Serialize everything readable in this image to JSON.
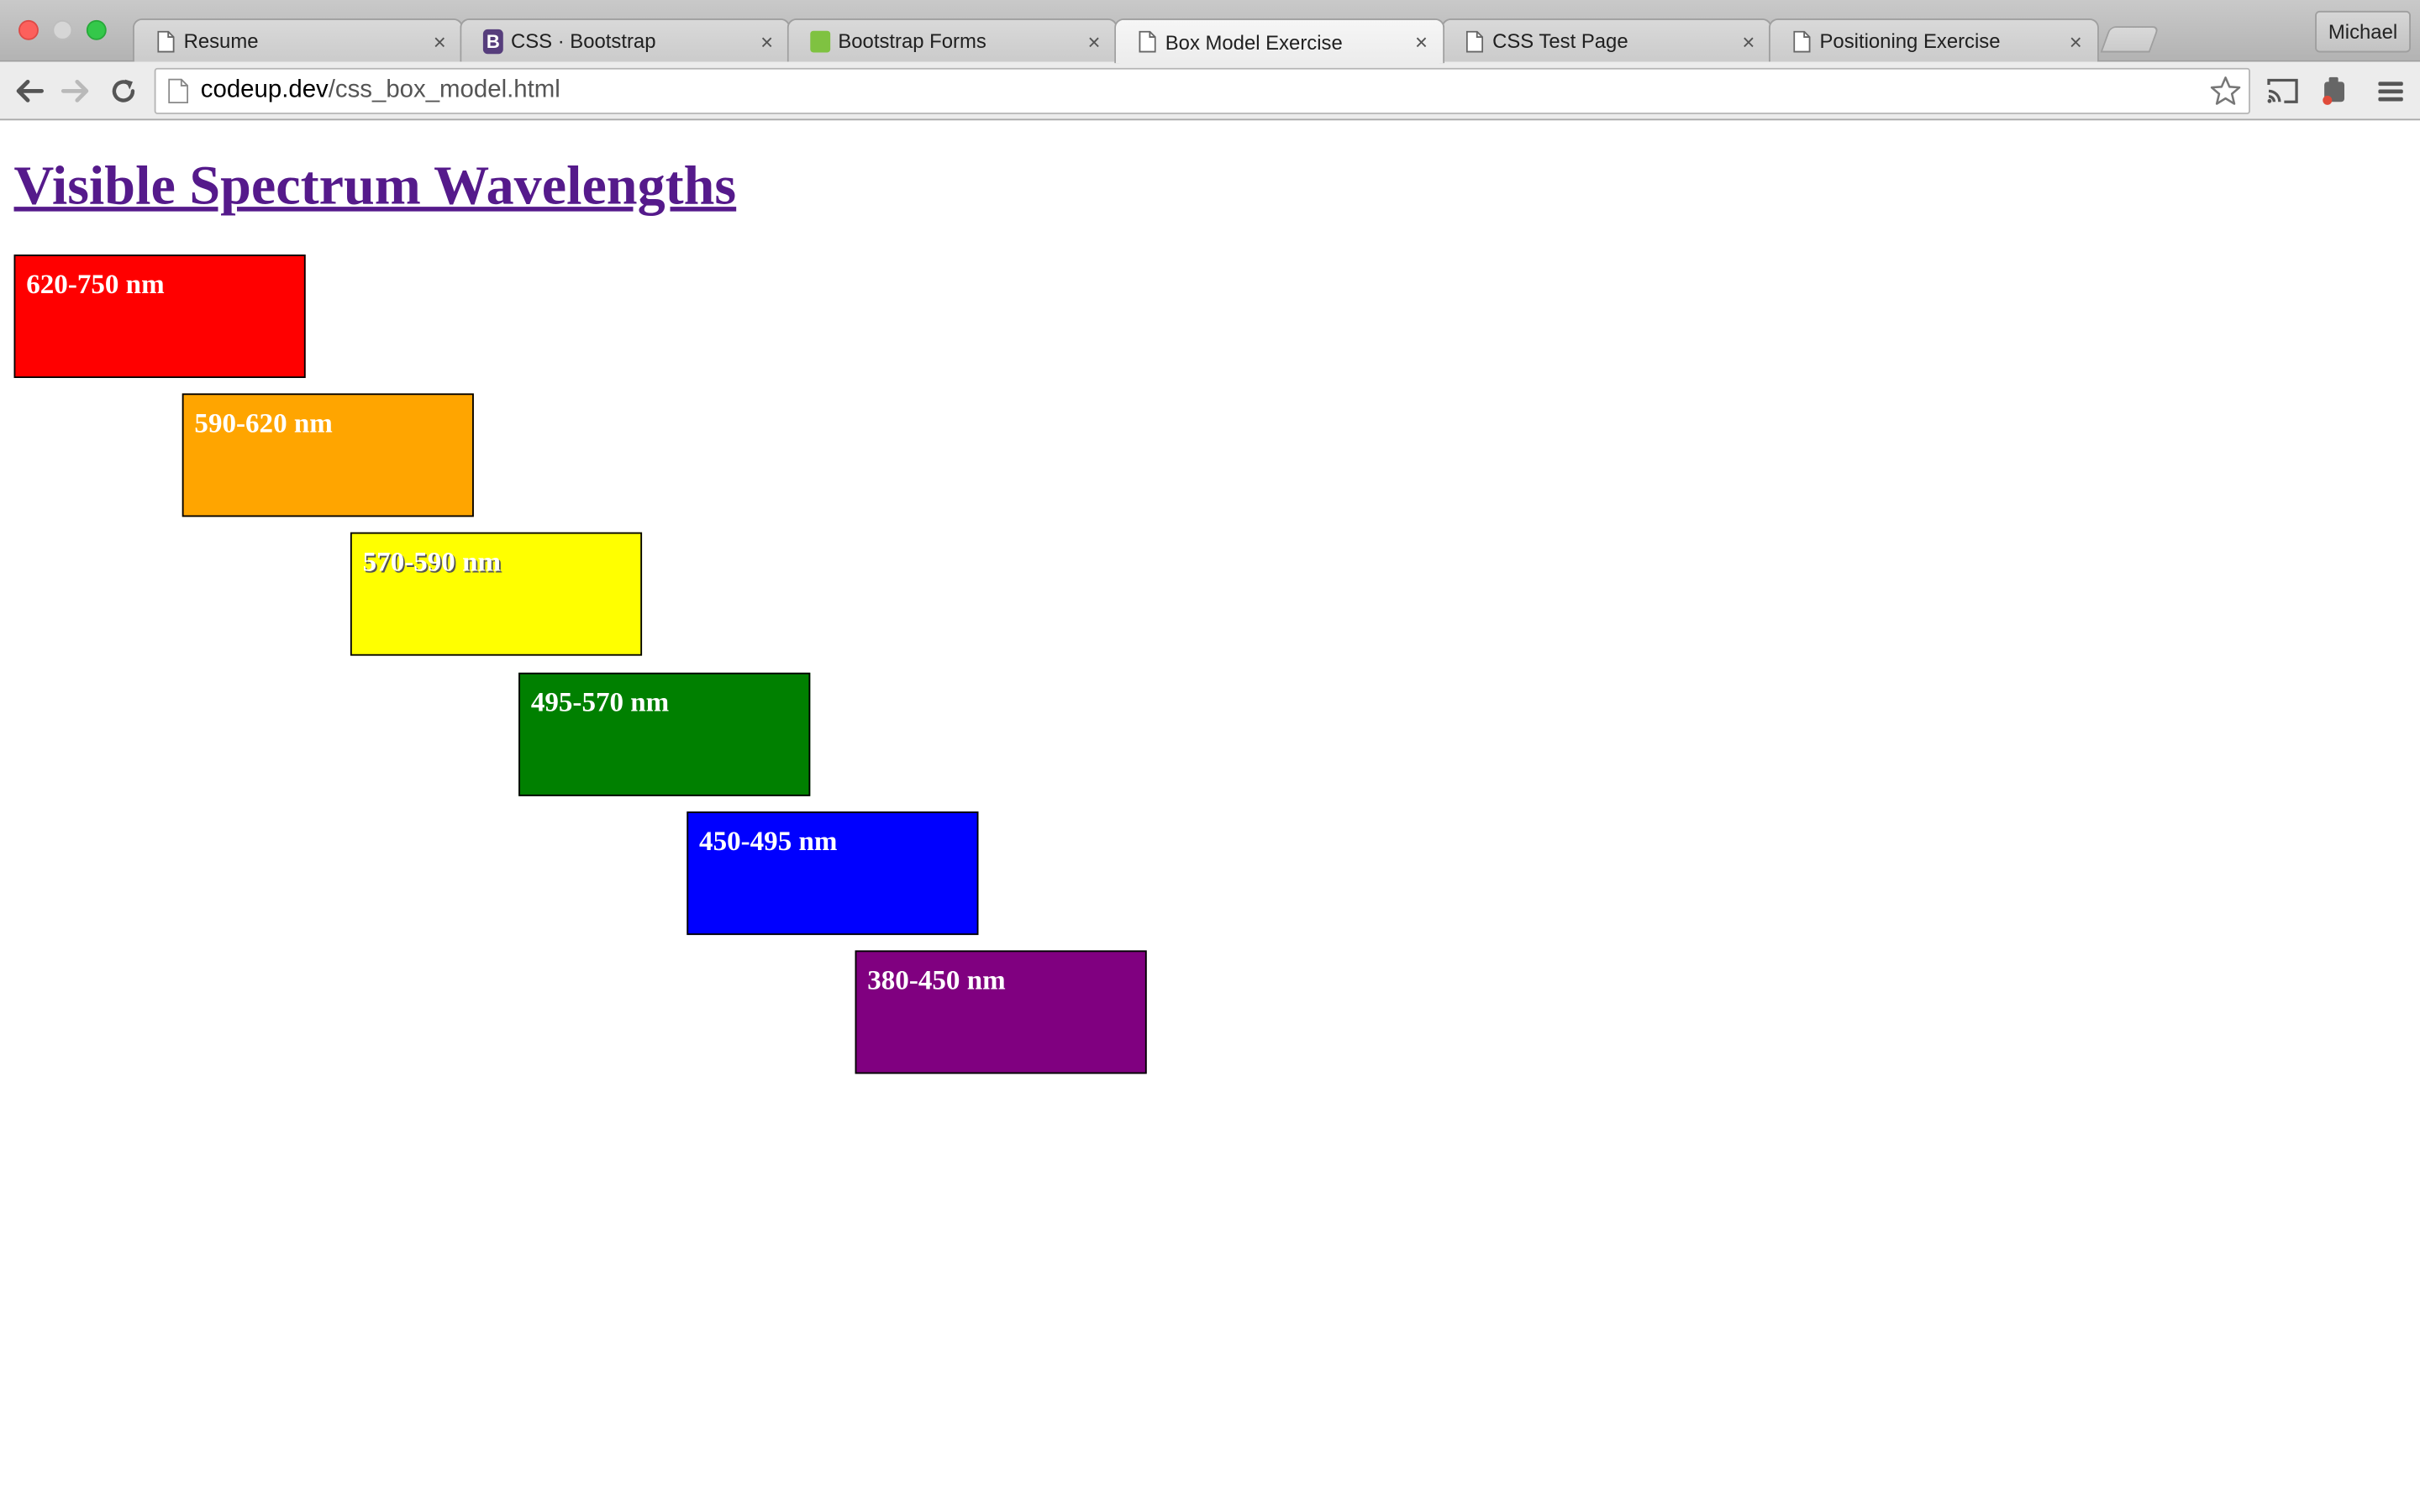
{
  "browser": {
    "tabs": [
      {
        "title": "Resume",
        "favicon": "page-icon"
      },
      {
        "title": "CSS · Bootstrap",
        "favicon": "bootstrap-icon"
      },
      {
        "title": "Bootstrap Forms",
        "favicon": "bootstrap-forms-icon"
      },
      {
        "title": "Box Model Exercise",
        "favicon": "page-icon",
        "active": true
      },
      {
        "title": "CSS Test Page",
        "favicon": "page-icon"
      },
      {
        "title": "Positioning Exercise",
        "favicon": "page-icon"
      }
    ],
    "tab_close_glyph": "×",
    "bootstrap_letter": "B",
    "profile_name": "Michael",
    "address": {
      "host": "codeup.dev",
      "path": "/css_box_model.html"
    }
  },
  "page": {
    "title": "Visible Spectrum Wavelengths",
    "title_color": "#551a8b",
    "bands": [
      {
        "label": "620-750 nm",
        "color": "#ff0000",
        "name": "red"
      },
      {
        "label": "590-620 nm",
        "color": "#ffa500",
        "name": "orange"
      },
      {
        "label": "570-590 nm",
        "color": "#ffff00",
        "name": "yellow"
      },
      {
        "label": "495-570 nm",
        "color": "#008000",
        "name": "green"
      },
      {
        "label": "450-495 nm",
        "color": "#0000ff",
        "name": "blue"
      },
      {
        "label": "380-450 nm",
        "color": "#800080",
        "name": "purple"
      }
    ]
  }
}
